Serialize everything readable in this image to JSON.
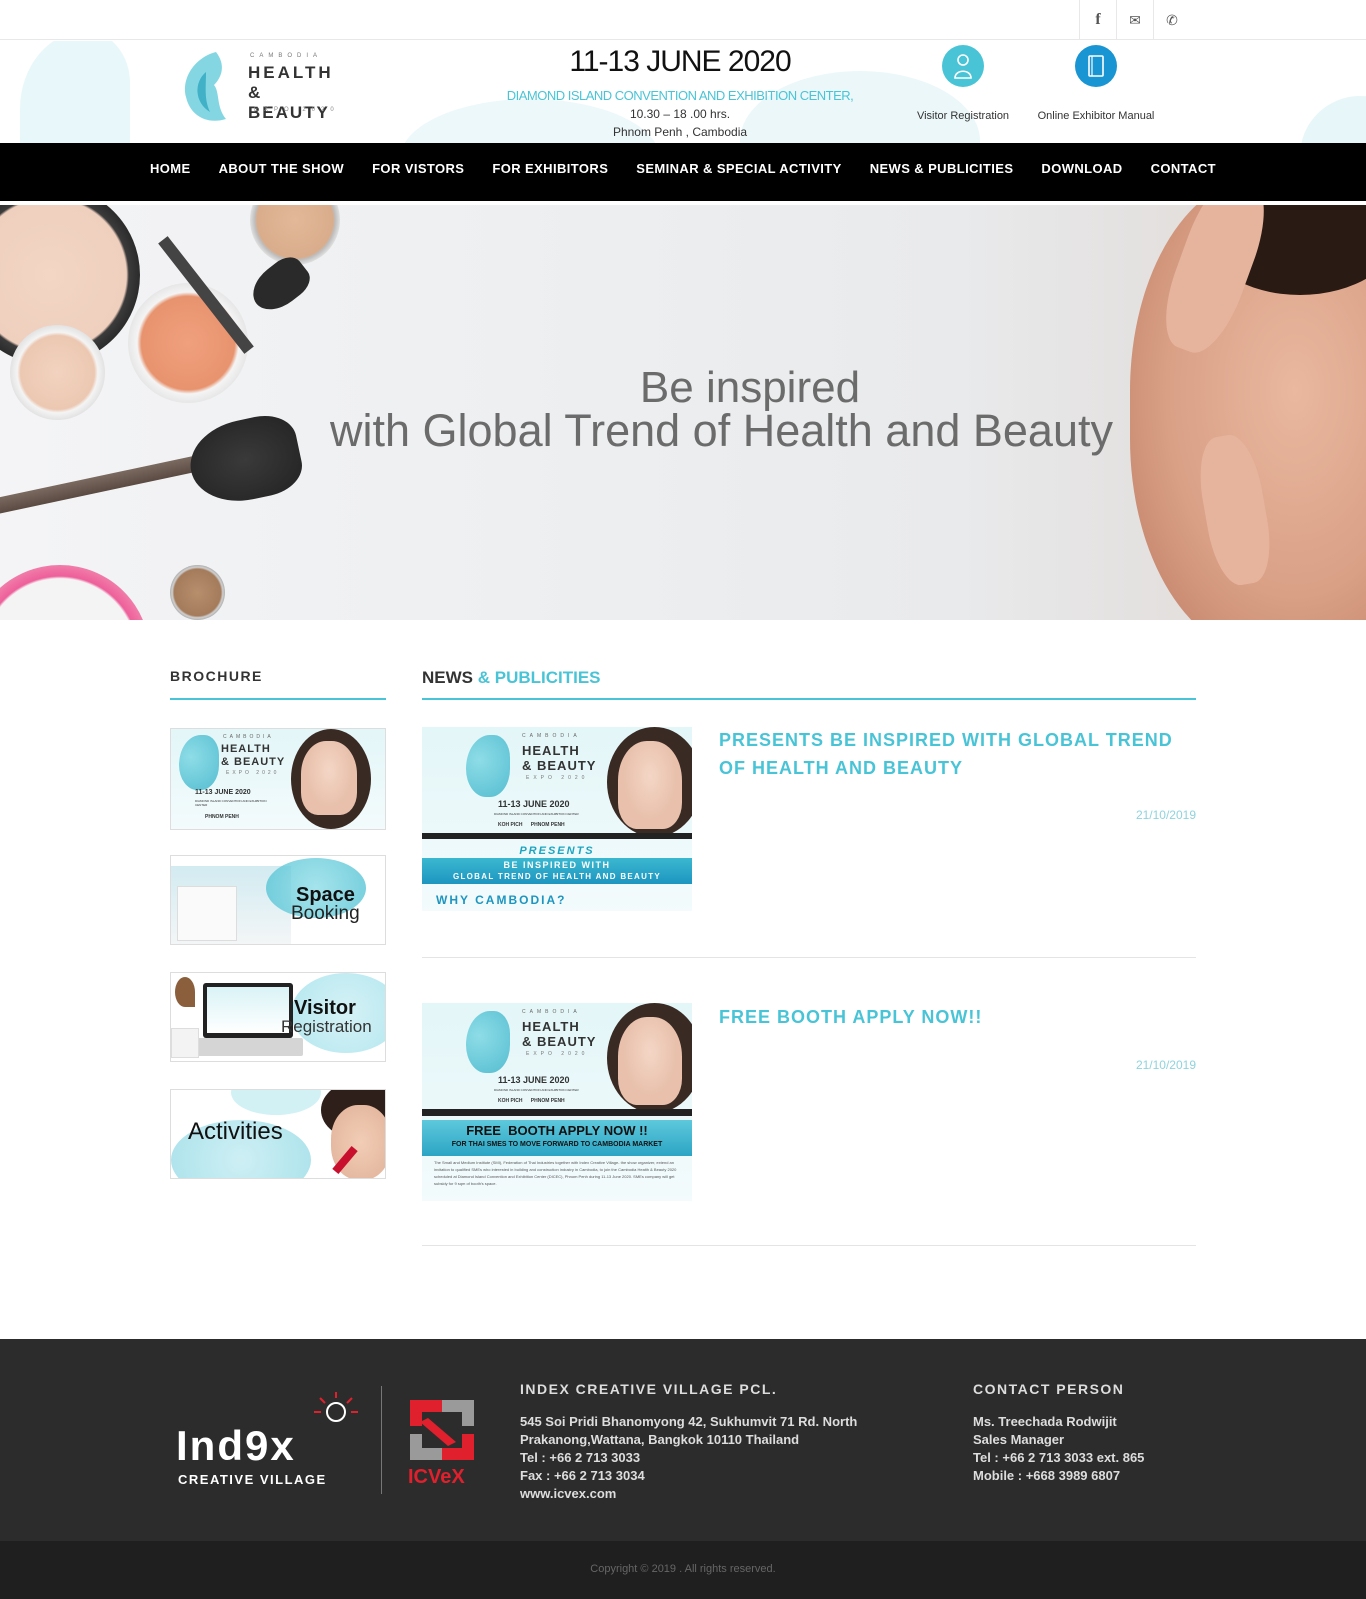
{
  "topbar": {
    "icons": [
      "facebook-icon",
      "mail-icon",
      "phone-icon"
    ],
    "facebook_glyph": "f",
    "mail_glyph": "✉",
    "phone_glyph": "✆"
  },
  "header": {
    "logo": {
      "country": "CAMBODIA",
      "line1": "HEALTH",
      "line2": "& BEAUTY",
      "line3": "EXPO 2020"
    },
    "date": "11-13 JUNE 2020",
    "venue": "DIAMOND ISLAND CONVENTION AND EXHIBITION CENTER,",
    "time": "10.30 – 18 .00 hrs.",
    "place": "Phnom Penh , Cambodia",
    "visitor_registration": "Visitor Registration",
    "exhibitor_manual": "Online Exhibitor Manual",
    "colors": {
      "accent": "#49c4d6",
      "manual_blue": "#1a95d3"
    }
  },
  "nav": {
    "items": [
      "HOME",
      "ABOUT THE SHOW",
      "FOR VISTORS",
      "FOR EXHIBITORS",
      "SEMINAR & SPECIAL ACTIVITY",
      "NEWS & PUBLICITIES",
      "DOWNLOAD",
      "CONTACT"
    ]
  },
  "hero": {
    "line1": "Be inspired",
    "line2": "with Global Trend of Health and Beauty"
  },
  "sidebar": {
    "title": "BROCHURE",
    "brochure": {
      "country": "CAMBODIA",
      "l1": "HEALTH",
      "l2": "& BEAUTY",
      "l3": "EXPO 2020",
      "date": "11-13 JUNE 2020",
      "venue": "DIAMOND ISLAND CONVENTION AND EXHIBITION CENTER",
      "city": "PHNOM PENH"
    },
    "space_booking": {
      "l1": "Space",
      "l2": "Booking"
    },
    "visitor_registration": {
      "l1": "Visitor",
      "l2": "Registration"
    },
    "activities": "Activities"
  },
  "news": {
    "title_dark": "NEWS",
    "title_accent": "& PUBLICITIES",
    "articles": [
      {
        "headline": "PRESENTS BE INSPIRED WITH GLOBAL TREND OF HEALTH AND BEAUTY",
        "date": "21/10/2019",
        "banner": {
          "country": "CAMBODIA",
          "l1": "HEALTH",
          "l2": "& BEAUTY",
          "l3": "EXPO 2020",
          "date": "11-13 JUNE 2020",
          "venue": "DIAMOND ISLAND CONVENTION AND EXHIBITION CENTER",
          "places": "KOH PICH      PHNOM PENH",
          "presents": "PRESENTS",
          "inspired": "BE INSPIRED WITH",
          "global": "GLOBAL TREND OF HEALTH AND BEAUTY",
          "why": "WHY CAMBODIA?"
        }
      },
      {
        "headline": "FREE BOOTH APPLY NOW!!",
        "date": "21/10/2019",
        "banner": {
          "country": "CAMBODIA",
          "l1": "HEALTH",
          "l2": "& BEAUTY",
          "l3": "EXPO 2020",
          "date": "11-13 JUNE 2020",
          "venue": "DIAMOND ISLAND CONVENTION AND EXHIBITION CENTER",
          "places": "KOH PICH      PHNOM PENH",
          "free": "FREE  BOOTH APPLY NOW !!",
          "sub": "FOR THAI SMES TO MOVE FORWARD TO CAMBODIA MARKET",
          "body": "The Small and Medium Institute (SMI), Federation of Thai Industries together with Index Creative Village- the show organizer, extend an invitation to qualified SMEs who interested in building and construction industry in Cambodia, to join the Cambodia Health & Beauty 2020 scheduled at Diamond Island Convention and Exhibition Center (DICEC), Phnom Penh during 11-13 June 2020. SMEs company will get subsidy for 9 sqm of booth's space."
        }
      }
    ]
  },
  "footer": {
    "logo_index": "Ind9x",
    "logo_creative": "CREATIVE VILLAGE",
    "logo_icvex": "ICVeX",
    "company_title": "INDEX CREATIVE VILLAGE PCL.",
    "address1": "545 Soi Pridi Bhanomyong 42, Sukhumvit 71 Rd. North",
    "address2": "Prakanong,Wattana, Bangkok 10110 Thailand",
    "tel": "Tel : +66 2 713 3033",
    "fax": "Fax : +66 2 713 3034",
    "web": "www.icvex.com",
    "contact_title": "CONTACT PERSON",
    "contact_name": "Ms. Treechada Rodwijit",
    "contact_role": "Sales Manager",
    "contact_tel": "Tel : +66 2 713 3033 ext. 865",
    "contact_mobile": "Mobile : +668 3989 6807",
    "copyright": "Copyright © 2019 . All rights reserved."
  }
}
